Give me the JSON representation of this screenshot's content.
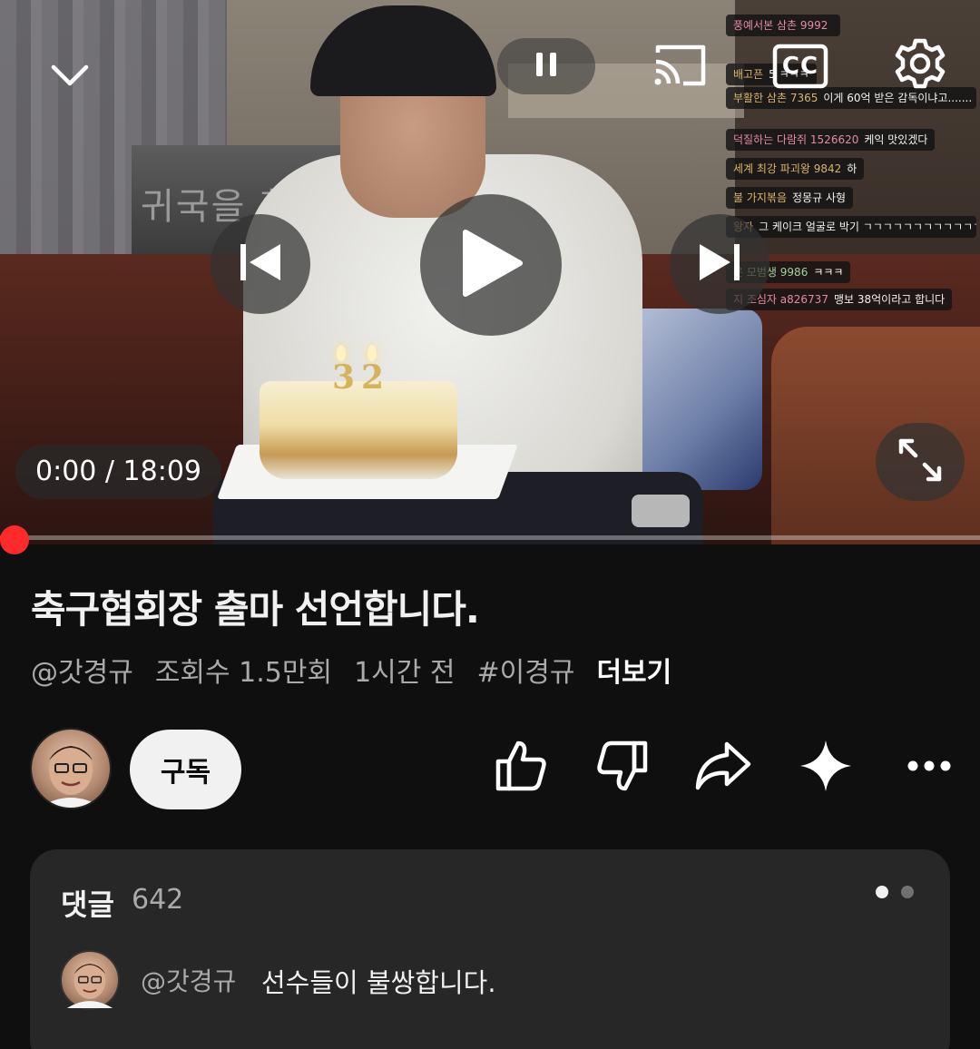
{
  "player": {
    "poster_text": "귀국을 환영",
    "candle_digits": [
      "3",
      "2"
    ],
    "time_current": "0:00",
    "time_total": "18:09",
    "time_display": "0:00 / 18:09",
    "progress_fraction": 0.0,
    "cc_label": "CC",
    "state": "paused"
  },
  "chat": [
    {
      "nick": "풍예서본 삼촌 9992",
      "msg": "",
      "nick_color": "pink"
    },
    {
      "nick": "배고픈",
      "msg": "5 ㅋㅋㅋ",
      "nick_color": "default"
    },
    {
      "nick": "부활한 삼촌 7365",
      "msg": "이게 60억 받은 감독이냐고.......",
      "nick_color": "default"
    },
    {
      "nick": "덕질하는 다람쥐 1526620",
      "msg": "케익 맛있겠다",
      "nick_color": "pink"
    },
    {
      "nick": "세계 최강 파괴왕 9842",
      "msg": "하",
      "nick_color": "default"
    },
    {
      "nick": "불 가지볶음",
      "msg": "정몽규 사형",
      "nick_color": "default"
    },
    {
      "nick": "왕자",
      "msg": "그 케이크 얼굴로 박기 ㄱㄱㄱㄱㄱㄱㄱㄱㄱㄱㄱㄱㄱㄱㄱㄱㄱㄱㄱㄱㄱㄱ",
      "nick_color": "default"
    },
    {
      "nick": "운 모범생 9986",
      "msg": "ㅋㅋㅋ",
      "nick_color": "green"
    },
    {
      "nick": "지 조심자 a826737",
      "msg": "맹보 38억이라고 합니다",
      "nick_color": "pink"
    }
  ],
  "video": {
    "title": "축구협회장 출마 선언합니다.",
    "channel_handle": "@갓경규",
    "views": "조회수 1.5만회",
    "uploaded": "1시간 전",
    "hashtag": "#이경규",
    "more_label": "더보기"
  },
  "actions": {
    "subscribe_label": "구독",
    "icons": [
      "thumbs-up-icon",
      "thumbs-down-icon",
      "share-icon",
      "sparkle-icon",
      "more-icon"
    ]
  },
  "comments": {
    "label": "댓글",
    "count": "642",
    "top_comment": {
      "author": "@갓경규",
      "text": "선수들이 불쌍합니다."
    }
  },
  "colors": {
    "background": "#0f0f0f",
    "progress": "#ff0000",
    "comments_panel": "#272727",
    "subscribe_bg": "#f1f1f1"
  }
}
